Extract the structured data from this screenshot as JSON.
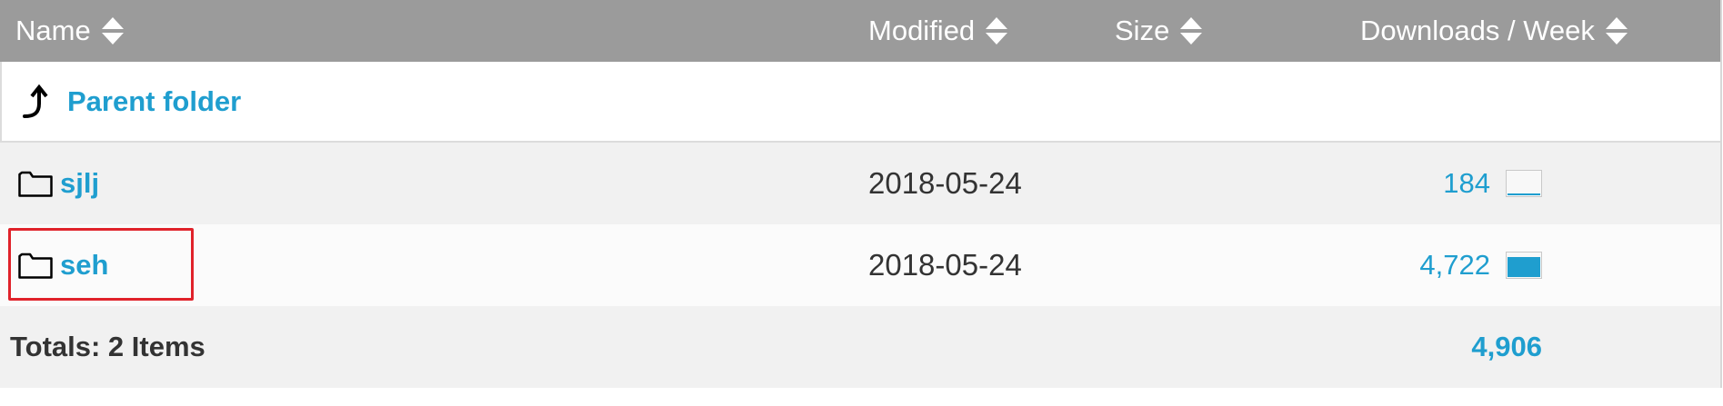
{
  "columns": {
    "name": "Name",
    "modified": "Modified",
    "size": "Size",
    "downloads": "Downloads / Week"
  },
  "icons": {
    "sort": "sort-icon",
    "parent": "arrow-up-icon",
    "folder": "folder-icon"
  },
  "parent": {
    "label": "Parent folder"
  },
  "rows": [
    {
      "name": "sjlj",
      "modified": "2018-05-24",
      "size": "",
      "downloads": "184",
      "activity": 0.06
    },
    {
      "name": "seh",
      "modified": "2018-05-24",
      "size": "",
      "downloads": "4,722",
      "activity": 0.85
    }
  ],
  "totals": {
    "label": "Totals: 2 Items",
    "downloads": "4,906"
  },
  "colors": {
    "header_bg": "#9b9b9b",
    "link": "#1f9ecf",
    "highlight": "#e0222a"
  }
}
